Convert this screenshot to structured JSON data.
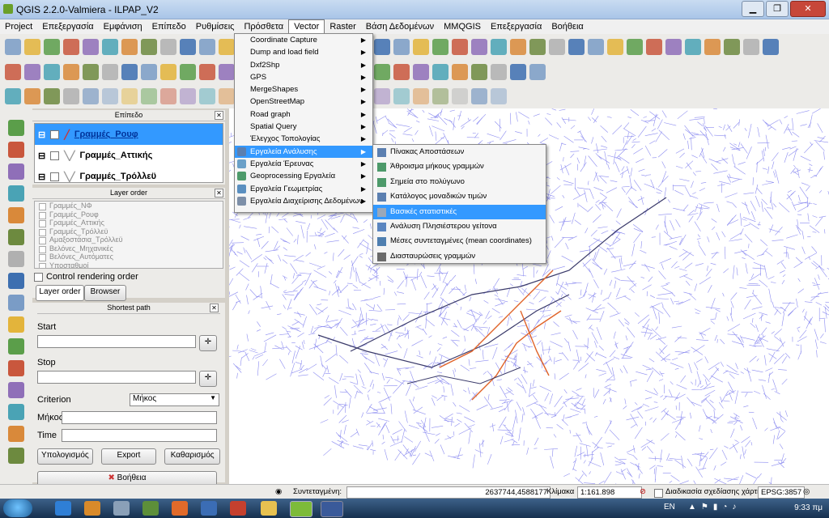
{
  "window": {
    "title": "QGIS 2.2.0-Valmiera - ILPAP_V2",
    "controls": [
      "▁",
      "❐",
      "✕"
    ]
  },
  "menubar": [
    {
      "label": "Project"
    },
    {
      "label": "Επεξεργασία"
    },
    {
      "label": "Εμφάνιση"
    },
    {
      "label": "Επίπεδο"
    },
    {
      "label": "Ρυθμίσεις"
    },
    {
      "label": "Πρόσθετα"
    },
    {
      "label": "Vector",
      "active": true
    },
    {
      "label": "Raster"
    },
    {
      "label": "Βάση Δεδομένων"
    },
    {
      "label": "MMQGIS"
    },
    {
      "label": "Επεξεργασία"
    },
    {
      "label": "Βοήθεια"
    }
  ],
  "vector_menu": [
    {
      "label": "Coordinate Capture",
      "submenu": true
    },
    {
      "label": "Dump and load field",
      "submenu": true
    },
    {
      "label": "Dxf2Shp",
      "submenu": true
    },
    {
      "label": "GPS",
      "submenu": true
    },
    {
      "label": "MergeShapes",
      "submenu": true
    },
    {
      "label": "OpenStreetMap",
      "submenu": true
    },
    {
      "label": "Road graph",
      "submenu": true
    },
    {
      "label": "Spatial Query",
      "submenu": true
    },
    {
      "label": "Έλεγχος Τοπολογίας",
      "submenu": true
    },
    {
      "label": "Εργαλεία Ανάλυσης",
      "submenu": true,
      "highlighted": true,
      "icon": "analysis-tools-icon"
    },
    {
      "label": "Εργαλεία Έρευνας",
      "submenu": true,
      "icon": "research-tools-icon"
    },
    {
      "label": "Geoprocessing Εργαλεία",
      "submenu": true,
      "icon": "geoprocessing-icon"
    },
    {
      "label": "Εργαλεία Γεωμετρίας",
      "submenu": true,
      "icon": "geometry-tools-icon"
    },
    {
      "label": "Εργαλεία Διαχείρισης Δεδομένων",
      "submenu": true,
      "icon": "data-management-icon"
    }
  ],
  "analysis_submenu": [
    {
      "label": "Πίνακας Αποστάσεων"
    },
    {
      "label": "Άθροισμα μήκους γραμμών"
    },
    {
      "label": "Σημεία στο πολύγωνο"
    },
    {
      "label": "Κατάλογος μοναδικών τιμών"
    },
    {
      "label": "Βασικές στατιστικές",
      "highlighted": true
    },
    {
      "label": "Ανάλυση Πλησιέστερου γείτονα"
    },
    {
      "label": "Μέσες συντεταγμένες (mean coordinates)"
    },
    {
      "label": "Διασταυρώσεις γραμμών"
    }
  ],
  "layers_panel": {
    "title": "Επίπεδο",
    "layers": [
      {
        "name": "Γραμμές_Ρουφ",
        "selected": true
      },
      {
        "name": "Γραμμές_Αττικής"
      },
      {
        "name": "Γραμμές_Τρόλλεϋ"
      }
    ]
  },
  "layer_order_panel": {
    "title": "Layer order",
    "items": [
      "Γραμμές_ΝΦ",
      "Γραμμές_Ρουφ",
      "Γραμμές_Αττικής",
      "Γραμμές_Τρόλλεϋ",
      "Αμαξοστάσια_Τρόλλεϋ",
      "Βελόνες_Μηχανικές",
      "Βελόνες_Αυτόματες",
      "Υποσταθμοί"
    ],
    "control_rendering_order": "Control rendering order",
    "tabs": [
      "Layer order",
      "Browser"
    ]
  },
  "shortest_path": {
    "title": "Shortest path",
    "start_label": "Start",
    "stop_label": "Stop",
    "criterion_label": "Criterion",
    "criterion_value": "Μήκος",
    "length_label": "Μήκος",
    "time_label": "Time",
    "calculate": "Υπολογισμός",
    "export": "Export",
    "clear": "Καθαρισμός",
    "help": "Βοήθεια"
  },
  "statusbar": {
    "coord_label": "Συντεταγμένη:",
    "coord_value": "2637744,4588177",
    "scale_label": "Κλίμακα",
    "scale_value": "1:161.898",
    "render_label": "Διαδικασία σχεδίασης χάρτη",
    "epsg": "EPSG:3857"
  },
  "taskbar": {
    "lang": "EN",
    "time": "9:33 πμ"
  },
  "colors": {
    "road_network": "#8c8cf0",
    "route_orange": "#e0642a",
    "route_dark": "#3a3a6a",
    "highlight": "#3399ff"
  }
}
